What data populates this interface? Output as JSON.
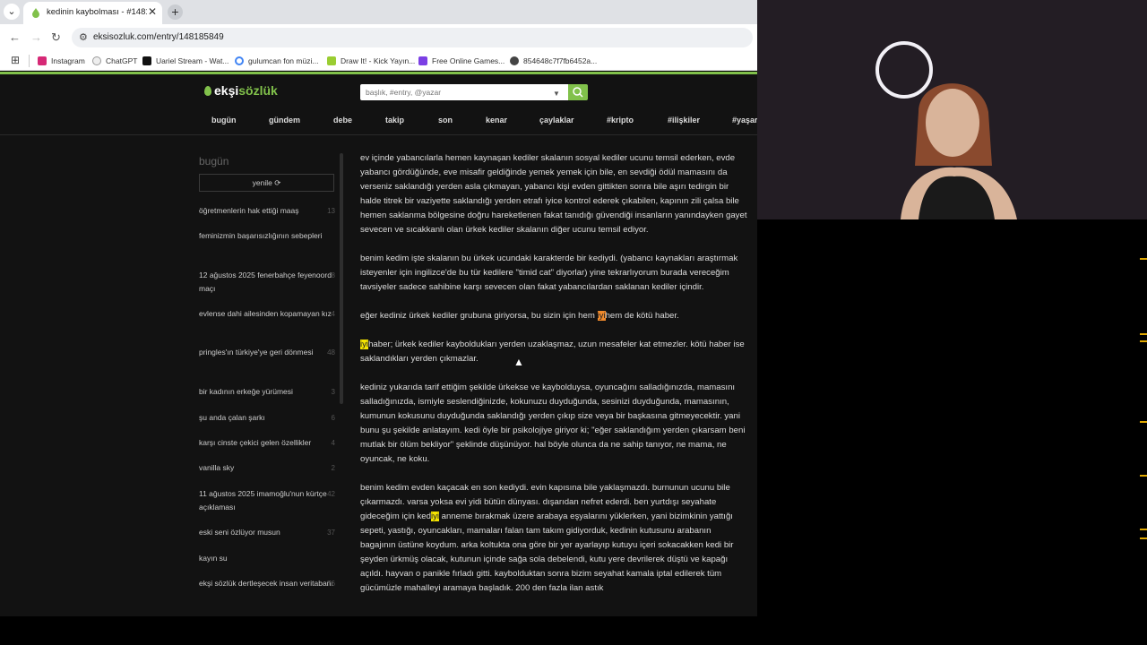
{
  "browser": {
    "tab_title": "kedinin kaybolması - #1481858",
    "url": "eksisozluk.com/entry/148185849",
    "bookmarks": [
      {
        "label": "Instagram",
        "icon": "instagram-icon",
        "color": "#d62976"
      },
      {
        "label": "ChatGPT",
        "icon": "chatgpt-icon",
        "color": "#ffffff"
      },
      {
        "label": "Uariel Stream - Wat...",
        "icon": "kick-icon",
        "color": "#53fc18"
      },
      {
        "label": "gulumcan fon müzi...",
        "icon": "google-icon",
        "color": "#4285f4"
      },
      {
        "label": "Draw It! - Kick Yayın...",
        "icon": "draw-it-icon",
        "color": "#9acd32"
      },
      {
        "label": "Free Online Games...",
        "icon": "games-icon",
        "color": "#7b3fe4"
      },
      {
        "label": "854648c7f7fb6452a...",
        "icon": "globe-icon",
        "color": "#444444"
      }
    ]
  },
  "site": {
    "logo_a": "ekşi",
    "logo_b": "sözlük",
    "search_placeholder": "başlık, #entry, @yazar",
    "nav": [
      "bugün",
      "gündem",
      "debe",
      "takip",
      "son",
      "kenar",
      "çaylaklar",
      "#kripto",
      "#ilişkiler",
      "#yaşar"
    ]
  },
  "sidebar": {
    "heading": "bugün",
    "refresh": "yenile ⟳",
    "topics": [
      {
        "title": "öğretmenlerin hak ettiği maaş",
        "count": "13"
      },
      {
        "title": "feminizmin başarısızlığının sebepleri",
        "count": ""
      },
      {
        "title": "12 ağustos 2025 fenerbahçe feyenoord maçı",
        "count": "8"
      },
      {
        "title": "evlense dahi ailesinden kopamayan kız",
        "count": "4"
      },
      {
        "title": "pringles'ın türkiye'ye geri dönmesi",
        "count": "48"
      },
      {
        "title": "bir kadının erkeğe yürümesi",
        "count": "3"
      },
      {
        "title": "şu anda çalan şarkı",
        "count": "6"
      },
      {
        "title": "karşı cinste çekici gelen özellikler",
        "count": "4"
      },
      {
        "title": "vanilla sky",
        "count": "2"
      },
      {
        "title": "11 ağustos 2025 imamoğlu'nun kürtçe açıklaması",
        "count": "42"
      },
      {
        "title": "eski seni özlüyor musun",
        "count": "37"
      },
      {
        "title": "kayın su",
        "count": ""
      },
      {
        "title": "ekşi sözlük dertleşecek insan veritabanı",
        "count": "76"
      }
    ]
  },
  "entry": {
    "p1": "ev içinde yabancılarla hemen kaynaşan kediler skalanın sosyal kediler ucunu temsil ederken, evde yabancı gördüğünde, eve misafir geldiğinde yemek yemek için bile, en sevdiği ödül mamasını da verseniz saklandığı yerden asla çıkmayan, yabancı kişi evden gittikten sonra bile aşırı tedirgin bir halde titrek bir vaziyette saklandığı yerden etrafı iyice kontrol ederek çıkabilen, kapının zili çalsa bile hemen saklanma bölgesine doğru hareketlenen fakat tanıdığı güvendiği insanların yanındayken gayet sevecen ve sıcakkanlı olan ürkek kediler skalanın diğer ucunu temsil ediyor.",
    "p2": "benim kedim işte skalanın bu ürkek ucundaki karakterde bir kediydi. (yabancı kaynakları araştırmak isteyenler için ingilizce'de bu tür kedilere \"timid cat\" diyorlar) yine tekrarlıyorum burada vereceğim tavsiyeler sadece sahibine karşı sevecen olan fakat yabancılardan saklanan kediler içindir.",
    "p3_pre": "eğer kediniz ürkek kediler grubuna giriyorsa, bu sizin için hem ",
    "p3_hl": "iyi",
    "p3_post": "hem de kötü haber.",
    "p4_hl": "iyi",
    "p4_post": "haber; ürkek kediler kayboldukları yerden uzaklaşmaz, uzun mesafeler kat etmezler. kötü haber ise saklandıkları yerden çıkmazlar.",
    "p5": "kediniz yukarıda tarif ettiğim şekilde ürkekse ve kaybolduysa, oyuncağını salladığınızda, mamasını salladığınızda, ismiyle seslendiğinizde, kokunuzu duyduğunda, sesinizi duyduğunda, mamasının, kumunun kokusunu duyduğunda saklandığı yerden çıkıp size veya bir başkasına gitmeyecektir. yani bunu şu şekilde anlatayım. kedi öyle bir psikolojiye giriyor ki; \"eğer saklandığım yerden çıkarsam beni mutlak bir ölüm bekliyor\" şeklinde düşünüyor. hal böyle olunca da ne sahip tanıyor, ne mama, ne oyuncak, ne koku.",
    "p6_pre": "benim kedim evden kaçacak en son kediydi. evin kapısına bile yaklaşmazdı. burnunun ucunu bile çıkarmazdı. varsa yoksa evi yidi bütün dünyası. dışarıdan nefret ederdi. ben yurtdışı seyahate gideceğim için ked",
    "p6_hl": "iyi",
    "p6_post": " anneme bırakmak üzere arabaya eşyalarını yüklerken, yani bizimkinin yattığı sepeti, yastığı, oyuncakları, mamaları falan tam takım gidiyorduk, kedinin kutusunu arabanın bagajının üstüne koydum. arka koltukta ona göre bir yer ayarlayıp kutuyu içeri sokacakken kedi bir şeyden ürkmüş olacak, kutunun içinde sağa sola debelendi, kutu yere devrilerek düştü ve kapağı açıldı. hayvan o panikle fırladı gitti. kaybolduktan sonra bizim seyahat kamala iptal edilerek tüm gücümüzle mahalleyi aramaya başladık. 200 den fazla ilan astık"
  },
  "colors": {
    "accent": "#81c14b",
    "highlight_yellow": "#f5e400",
    "highlight_orange": "#f08a2c"
  }
}
